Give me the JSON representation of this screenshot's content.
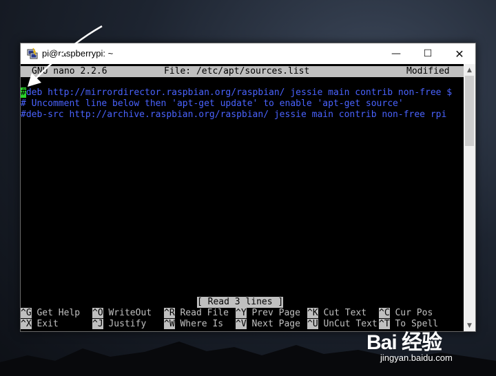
{
  "window": {
    "title": "pi@raspberrypi: ~",
    "minimize_glyph": "—",
    "maximize_glyph": "☐",
    "close_glyph": "✕"
  },
  "nano": {
    "version": "GNU nano 2.2.6",
    "file": "File: /etc/apt/sources.list",
    "modified": "Modified",
    "lines": {
      "l1_cursor": "#",
      "l1_rest": "deb http://mirrordirector.raspbian.org/raspbian/ jessie main contrib non-free $",
      "l2": "# Uncomment line below then 'apt-get update' to enable 'apt-get source'",
      "l3": "#deb-src http://archive.raspbian.org/raspbian/ jessie main contrib non-free rpi"
    },
    "status_message": "[ Read 3 lines ]",
    "shortcuts_row1": [
      {
        "key": "^G",
        "label": " Get Help"
      },
      {
        "key": "^O",
        "label": " WriteOut"
      },
      {
        "key": "^R",
        "label": " Read File"
      },
      {
        "key": "^Y",
        "label": " Prev Page"
      },
      {
        "key": "^K",
        "label": " Cut Text"
      },
      {
        "key": "^C",
        "label": " Cur Pos"
      }
    ],
    "shortcuts_row2": [
      {
        "key": "^X",
        "label": " Exit"
      },
      {
        "key": "^J",
        "label": " Justify"
      },
      {
        "key": "^W",
        "label": " Where Is"
      },
      {
        "key": "^V",
        "label": " Next Page"
      },
      {
        "key": "^U",
        "label": " UnCut Text"
      },
      {
        "key": "^T",
        "label": " To Spell"
      }
    ]
  },
  "watermark": {
    "logo": "Bai 经验",
    "url": "jingyan.baidu.com"
  },
  "colors": {
    "cursor": "#2ad62a",
    "comment_text": "#4a63ff",
    "inverse_bar": "#c0c0c0"
  }
}
